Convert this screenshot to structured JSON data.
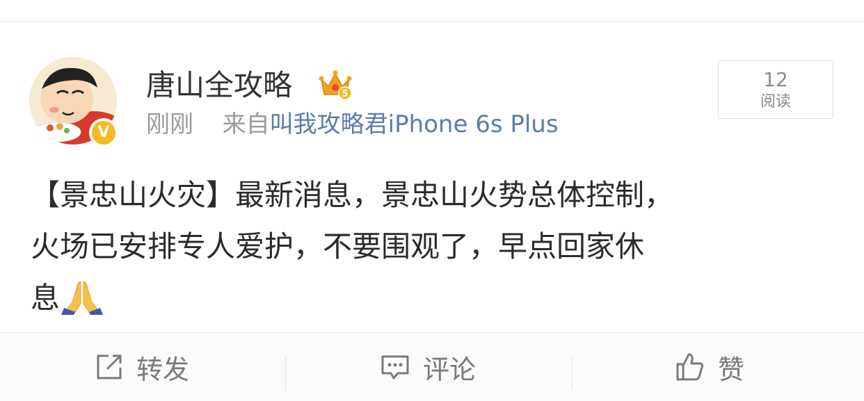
{
  "post": {
    "username": "唐山全攻略",
    "time": "刚刚",
    "from_prefix": "来自",
    "source": "叫我攻略君iPhone 6s Plus",
    "read_count": "12",
    "read_label": "阅读",
    "body_lines": [
      "【景忠山火灾】最新消息，景忠山火势总体控制，",
      "火场已安排专人爱护，不要围观了，早点回家休",
      "息"
    ]
  },
  "badges": {
    "verified": "V",
    "crown_level": "5"
  },
  "actions": {
    "repost_label": "转发",
    "comment_label": "评论",
    "like_label": "赞"
  },
  "icons": [
    "crown-vip-icon",
    "verified-icon",
    "pray-emoji",
    "repost-icon",
    "comment-icon",
    "like-icon"
  ],
  "colors": {
    "username": "#333333",
    "meta": "#9a9a9a",
    "source_link": "#5b7cab",
    "verified": "#f5b921",
    "crown": "#f0a21e"
  }
}
